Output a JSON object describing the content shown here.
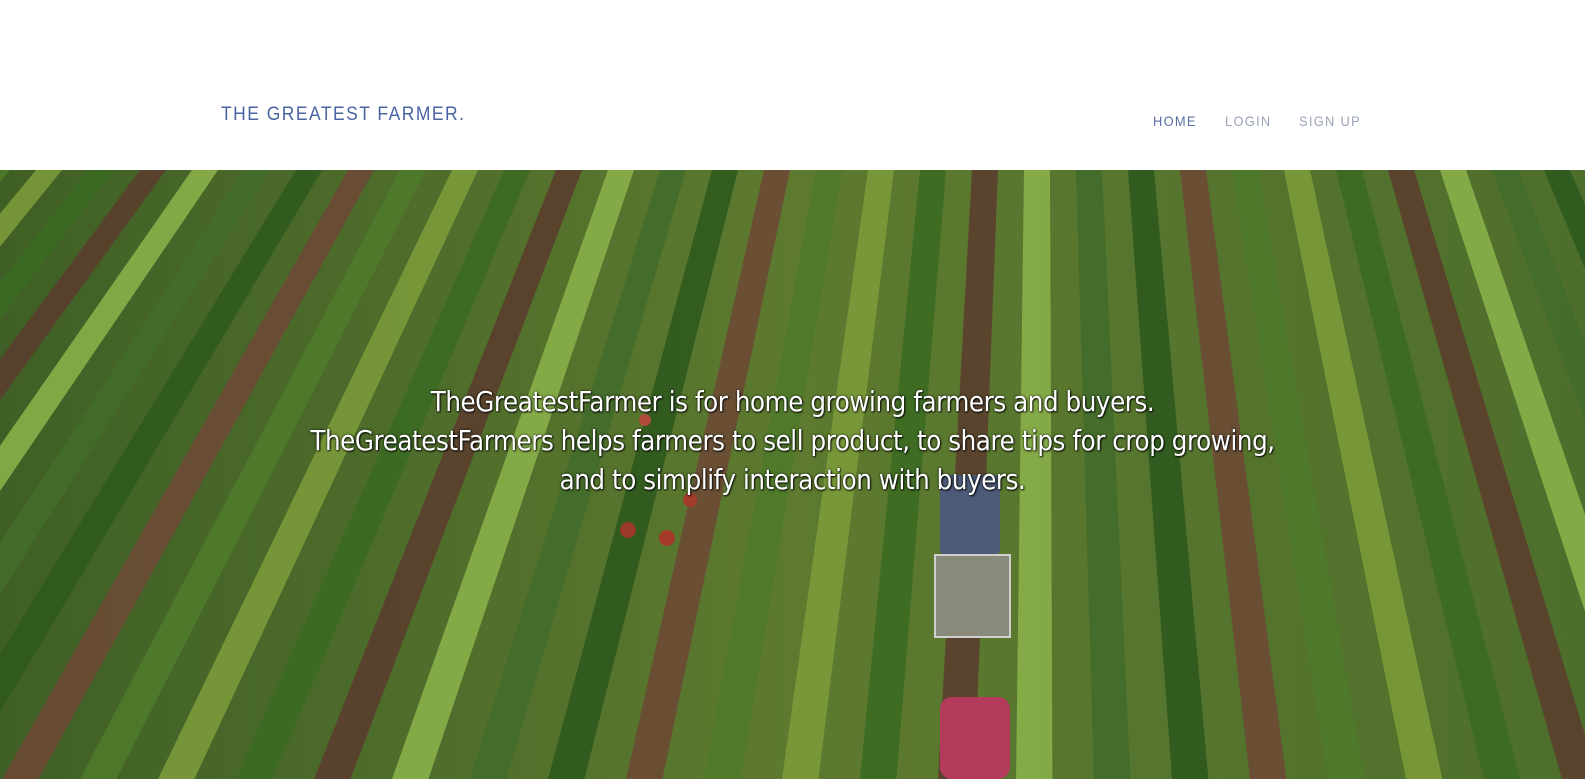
{
  "header": {
    "brand": "THE GREATEST FARMER.",
    "nav": {
      "home": "HOME",
      "login": "LOGIN",
      "signup": "SIGN UP"
    }
  },
  "hero": {
    "lines": [
      "TheGreatestFarmer is for home growing farmers and buyers.",
      "TheGreatestFarmers helps farmers to sell product, to share tips for crop growing,",
      "and to simplify interaction with buyers."
    ],
    "image": "aerial-crop-field-photo"
  },
  "colors": {
    "brand": "#4a63a3",
    "nav_active": "#5a6fa8",
    "nav_inactive": "#9aa3b8"
  }
}
